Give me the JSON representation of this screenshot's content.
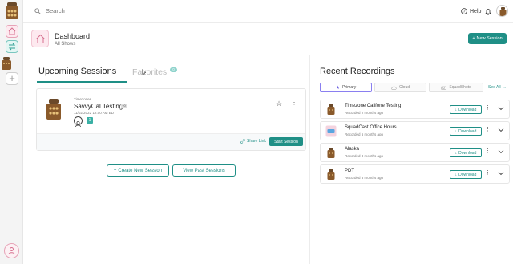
{
  "topbar": {
    "search_placeholder": "Search",
    "help_label": "Help"
  },
  "header": {
    "title": "Dashboard",
    "subtitle": "All Shows",
    "new_session_label": "New Session"
  },
  "left_panel": {
    "tabs": [
      {
        "label": "Upcoming Sessions",
        "active": true
      },
      {
        "label": "Favorites",
        "badge": "0",
        "active": false
      }
    ],
    "session": {
      "show": "Timezones",
      "title": "SavvyCal Testing",
      "tag": "+0",
      "datetime": "11/02/2022 12:00 AM EDT",
      "participants": "1",
      "share_label": "Share Link",
      "start_label": "Start Session"
    },
    "create_label": "Create New Session",
    "past_label": "View Past Sessions"
  },
  "right_panel": {
    "title": "Recent Recordings",
    "filters": [
      {
        "label": "Primary",
        "active": true
      },
      {
        "label": "Cloud",
        "active": false
      },
      {
        "label": "SquadShots",
        "active": false
      }
    ],
    "see_all_label": "See All",
    "recordings": [
      {
        "name": "Timezone Califone Testing",
        "recorded": "Recorded 2 months ago",
        "download_label": "Download"
      },
      {
        "name": "SquadCast Office Hours",
        "recorded": "Recorded 6 months ago",
        "download_label": "Download"
      },
      {
        "name": "Alaska",
        "recorded": "Recorded 8 months ago",
        "download_label": "Download"
      },
      {
        "name": "PDT",
        "recorded": "Recorded 8 months ago",
        "download_label": "Download"
      }
    ]
  },
  "colors": {
    "accent": "#1f8f86",
    "pink": "#fde9ef",
    "purple": "#8a7ff0"
  }
}
